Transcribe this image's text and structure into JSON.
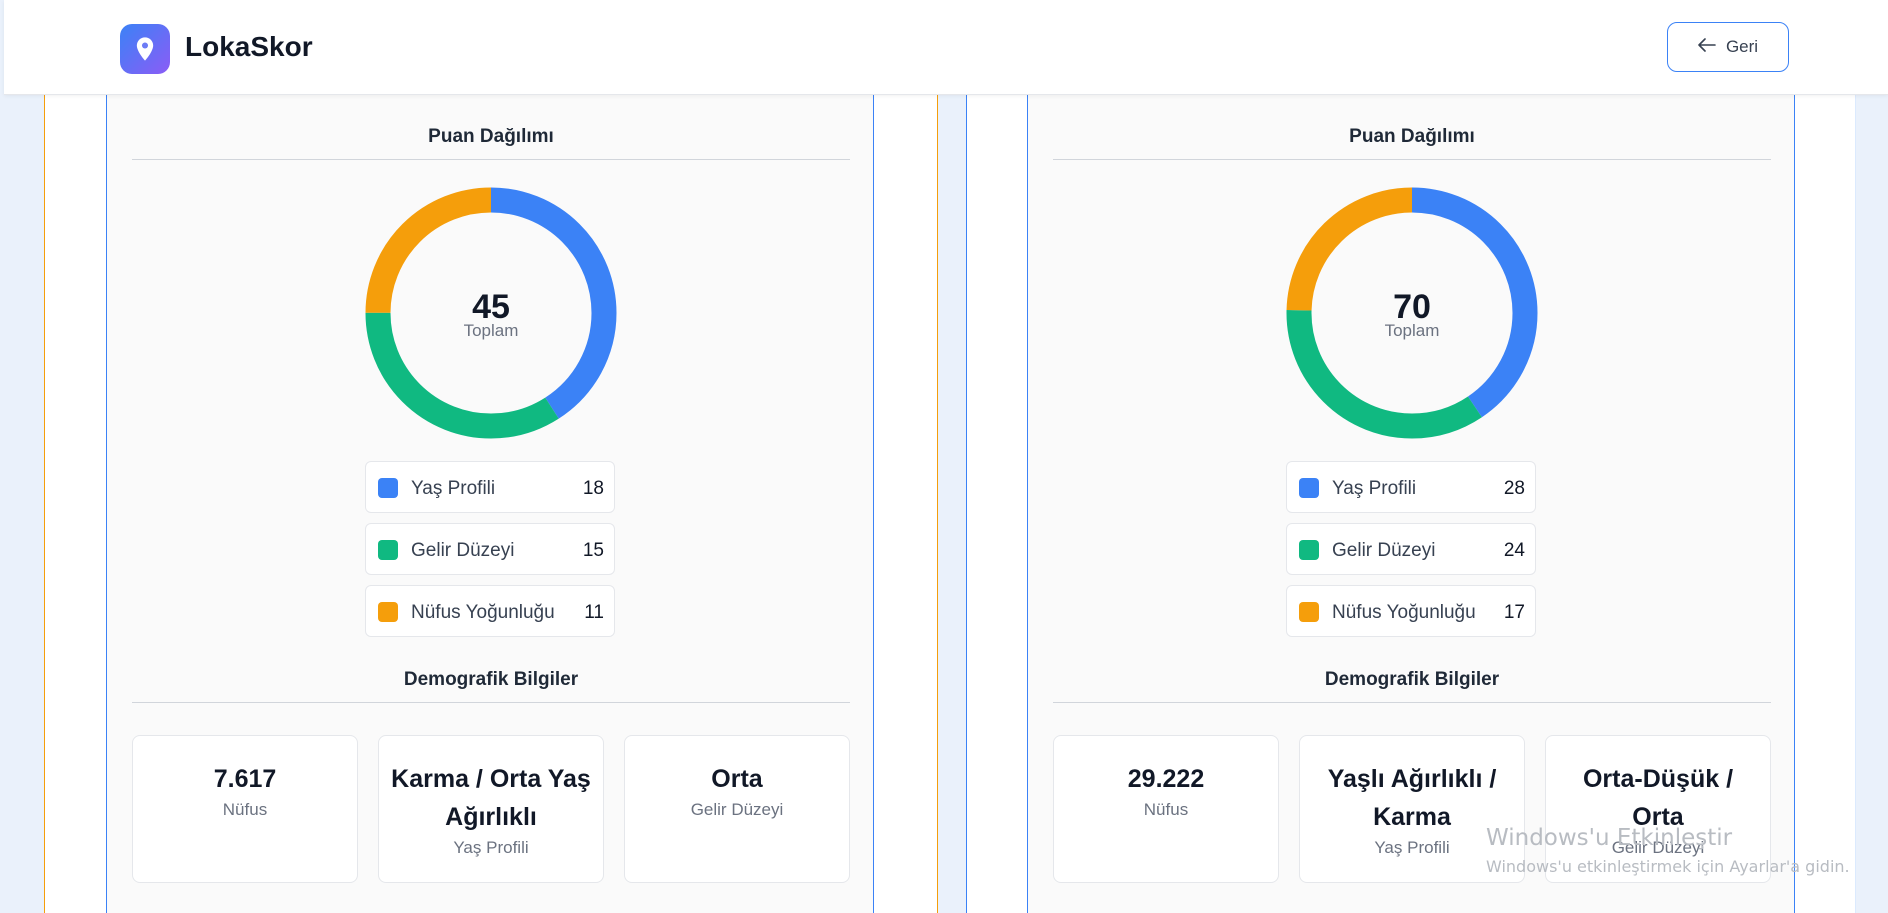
{
  "header": {
    "brand": "LokaSkor",
    "back_label": "Geri"
  },
  "colors": {
    "yas": "#3b82f6",
    "gelir": "#10b981",
    "nufus": "#f59e0b",
    "accent": "#3b82f6"
  },
  "panels": [
    {
      "score_title": "Puan Dağılımı",
      "total": "45",
      "total_caption": "Toplam",
      "legend": [
        {
          "label": "Yaş Profili",
          "value": 18
        },
        {
          "label": "Gelir Düzeyi",
          "value": 15
        },
        {
          "label": "Nüfus Yoğunluğu",
          "value": 11
        }
      ],
      "demo_title": "Demografik Bilgiler",
      "stats": [
        {
          "value": "7.617",
          "label": "Nüfus"
        },
        {
          "value": "Karma / Orta Yaş Ağırlıklı",
          "label": "Yaş Profili"
        },
        {
          "value": "Orta",
          "label": "Gelir Düzeyi"
        }
      ]
    },
    {
      "score_title": "Puan Dağılımı",
      "total": "70",
      "total_caption": "Toplam",
      "legend": [
        {
          "label": "Yaş Profili",
          "value": 28
        },
        {
          "label": "Gelir Düzeyi",
          "value": 24
        },
        {
          "label": "Nüfus Yoğunluğu",
          "value": 17
        }
      ],
      "demo_title": "Demografik Bilgiler",
      "stats": [
        {
          "value": "29.222",
          "label": "Nüfus"
        },
        {
          "value": "Yaşlı Ağırlıklı / Karma",
          "label": "Yaş Profili"
        },
        {
          "value": "Orta-Düşük / Orta",
          "label": "Gelir Düzeyi"
        }
      ]
    }
  ],
  "watermark": {
    "line1": "Windows'u Etkinleştir",
    "line2": "Windows'u etkinleştirmek için Ayarlar'a gidin."
  }
}
